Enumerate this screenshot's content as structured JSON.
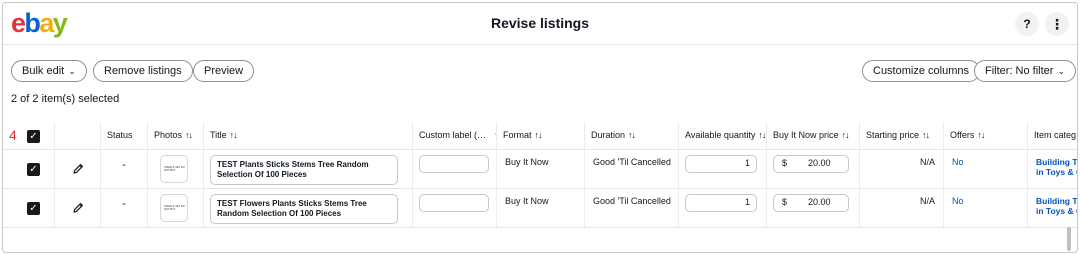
{
  "header": {
    "logo": {
      "e": "e",
      "b": "b",
      "a": "a",
      "y": "y"
    },
    "title": "Revise listings",
    "help_label": "?",
    "more_label": "⋮"
  },
  "toolbar": {
    "bulk_edit": "Bulk edit",
    "remove_listings": "Remove listings",
    "preview": "Preview",
    "customize_columns": "Customize columns",
    "filter": "Filter: No filter",
    "chevron": "⌄"
  },
  "selection_text": "2 of 2 item(s) selected",
  "step_marker": "4",
  "table": {
    "sort_icon": "↑↓",
    "headers": {
      "status": "Status",
      "photos": "Photos",
      "title": "Title",
      "custom_label": "Custom label (…",
      "format": "Format",
      "duration": "Duration",
      "available_quantity": "Available quantity",
      "buy_it_now_price": "Buy It Now price",
      "starting_price": "Starting price",
      "offers": "Offers",
      "item_category": "Item categ"
    },
    "rows": [
      {
        "status": "-",
        "thumb_text": "TABLE & SET DO NOT BUY",
        "title": "TEST Plants Sticks Stems Tree Random Selection Of 100 Pieces",
        "custom_label": "",
        "format": "Buy It Now",
        "duration": "Good 'Til Cancelled",
        "quantity": "1",
        "currency": "$",
        "price": "20.00",
        "starting_price": "N/A",
        "offers": "No",
        "category_line1": "Building T",
        "category_line2": "in Toys & G"
      },
      {
        "status": "-",
        "thumb_text": "TABLE & SET DO NOT BUY",
        "title": "TEST Flowers Plants Sticks Stems Tree Random Selection Of 100 Pieces",
        "custom_label": "",
        "format": "Buy It Now",
        "duration": "Good 'Til Cancelled",
        "quantity": "1",
        "currency": "$",
        "price": "20.00",
        "starting_price": "N/A",
        "offers": "No",
        "category_line1": "Building T",
        "category_line2": "in Toys & G"
      }
    ]
  },
  "colors": {
    "ebay_red": "#e53238",
    "ebay_blue": "#0064d2",
    "ebay_yellow": "#f5af02",
    "ebay_green": "#86b817",
    "link_blue": "#0654ba"
  }
}
